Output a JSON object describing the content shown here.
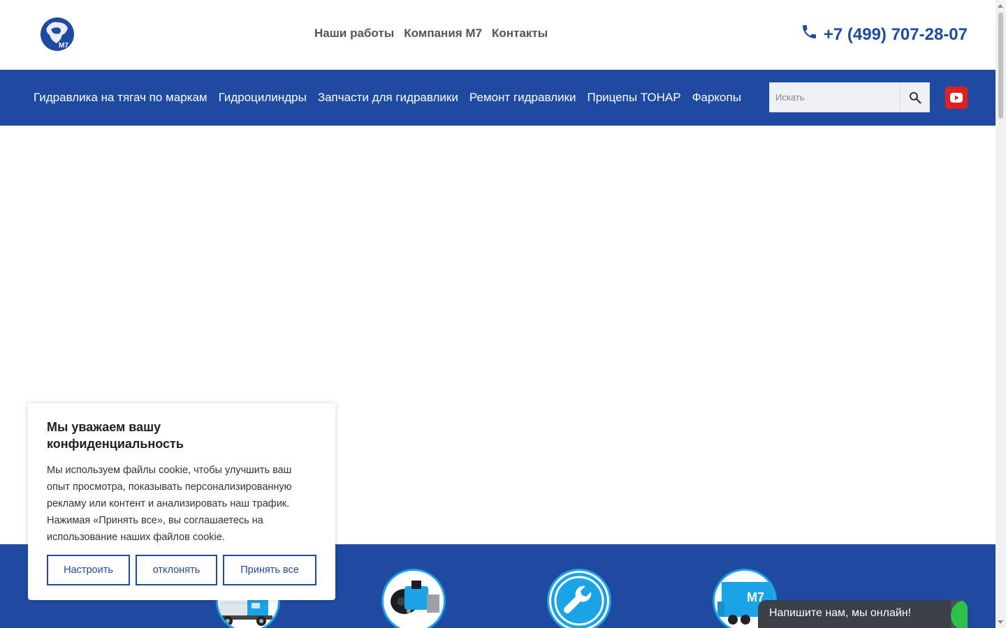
{
  "header": {
    "logo_alt": "M7",
    "nav": [
      "Наши работы",
      "Компания М7",
      "Контакты"
    ],
    "phone": "+7 (499) 707-28-07"
  },
  "mainnav": {
    "items": [
      "Гидравлика на тягач по маркам",
      "Гидроцилиндры",
      "Запчасти для гидравлики",
      "Ремонт гидравлики",
      "Прицепы ТОНАР",
      "Фаркопы"
    ],
    "search_placeholder": "Искать"
  },
  "services": {
    "icons": [
      "truck-image",
      "pump-image",
      "wrench-icon",
      "m7-trailer-image"
    ],
    "trailer_text": "M7"
  },
  "cookie": {
    "title": "Мы уважаем вашу конфиденциальность",
    "text": "Мы используем файлы cookie, чтобы улучшить ваш опыт просмотра, показывать персонализированную рекламу или контент и анализировать наш трафик. Нажимая «Принять все», вы соглашаетесь на использование наших файлов cookie.",
    "buttons": {
      "customize": "Настроить",
      "reject": "отклонять",
      "accept": "Принять все"
    }
  },
  "chat": {
    "label": "Напишите нам, мы онлайн!"
  },
  "colors": {
    "brand_blue": "#1f4aa1",
    "accent_cyan": "#1aa3e6",
    "youtube_red": "#e02020",
    "chat_dark": "#3a3f48",
    "online_green": "#2ec24a"
  }
}
